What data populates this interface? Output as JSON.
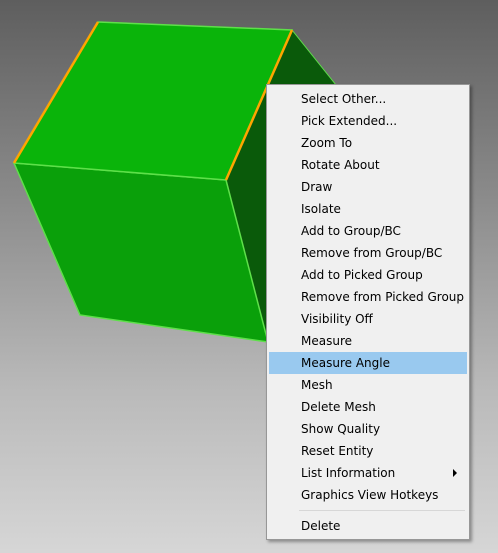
{
  "graphics_view": {
    "background_top": "#5e5e5e",
    "background_bottom": "#d6d6d6",
    "cube": {
      "top_face_color": "#0ab40a",
      "front_face_color": "#0aa00a",
      "side_face_color": "#0a5a0a",
      "edge_color": "#7cff4a",
      "selected_edge_color": "#ffa500"
    }
  },
  "context_menu": {
    "highlight_color": "#99c9ef",
    "items": [
      {
        "label": "Select Other...",
        "highlighted": false
      },
      {
        "label": "Pick Extended...",
        "highlighted": false
      },
      {
        "label": "Zoom To",
        "highlighted": false
      },
      {
        "label": "Rotate About",
        "highlighted": false
      },
      {
        "label": "Draw",
        "highlighted": false
      },
      {
        "label": "Isolate",
        "highlighted": false
      },
      {
        "label": "Add to Group/BC",
        "highlighted": false
      },
      {
        "label": "Remove from Group/BC",
        "highlighted": false
      },
      {
        "label": "Add to Picked Group",
        "highlighted": false
      },
      {
        "label": "Remove from Picked Group",
        "highlighted": false
      },
      {
        "label": "Visibility Off",
        "highlighted": false
      },
      {
        "label": "Measure",
        "highlighted": false
      },
      {
        "label": "Measure Angle",
        "highlighted": true
      },
      {
        "label": "Mesh",
        "highlighted": false
      },
      {
        "label": "Delete Mesh",
        "highlighted": false
      },
      {
        "label": "Show Quality",
        "highlighted": false
      },
      {
        "label": "Reset Entity",
        "highlighted": false
      },
      {
        "label": "List Information",
        "highlighted": false,
        "has_submenu": true
      },
      {
        "label": "Graphics View Hotkeys",
        "highlighted": false
      }
    ],
    "footer_item": {
      "label": "Delete"
    }
  }
}
